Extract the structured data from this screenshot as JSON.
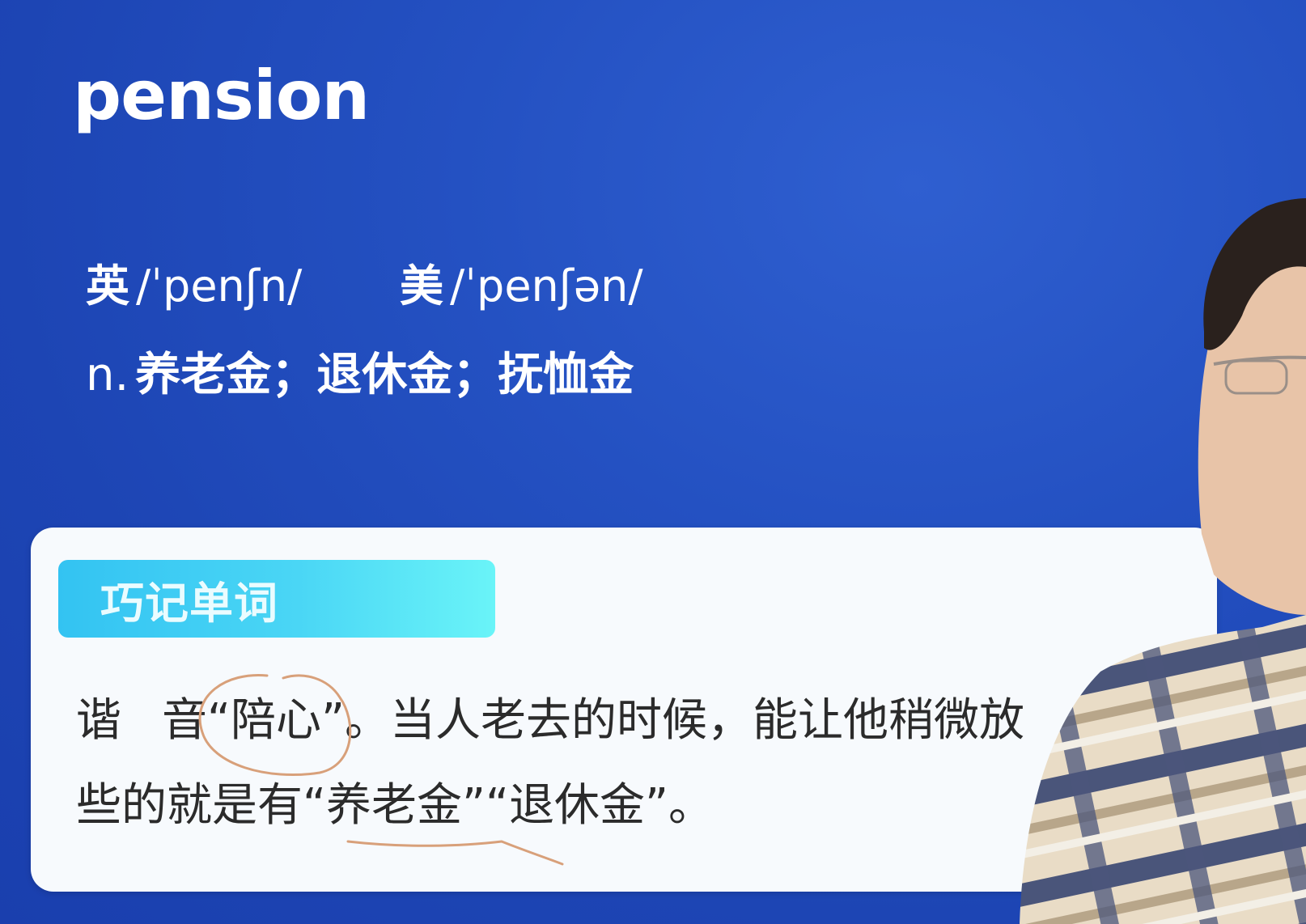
{
  "word": "pension",
  "phonetics": {
    "uk": {
      "label": "英",
      "ipa": "/ˈpenʃn/"
    },
    "us": {
      "label": "美",
      "ipa": "/ˈpenʃən/"
    }
  },
  "definition": {
    "pos": "n.",
    "meanings": "养老金；退休金；抚恤金"
  },
  "mnemonic_card": {
    "badge": "巧记单词",
    "line1": {
      "start": "谐",
      "rest": "音“陪心”。当人老去的时候，能让他稍微放"
    },
    "line2": "些的就是有“养老金”“退休金”。"
  },
  "colors": {
    "background": "#2451c2",
    "badge_start": "#33c3f2",
    "badge_end": "#6af4f8",
    "card": "#f7fafd",
    "annotation": "#d8a07a"
  }
}
